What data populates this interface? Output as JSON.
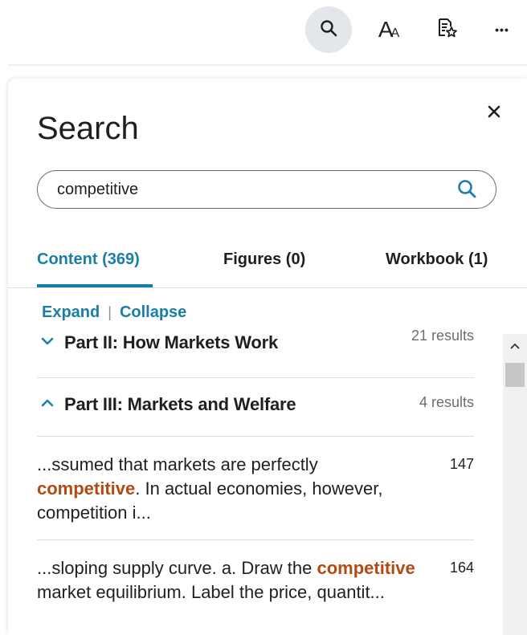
{
  "toolbar": {
    "buttons": [
      {
        "name": "search",
        "icon": "search-icon",
        "active": true
      },
      {
        "name": "font-size",
        "icon": "font-size-icon"
      },
      {
        "name": "bookmarks",
        "icon": "bookmark-list-icon"
      },
      {
        "name": "more",
        "icon": "more-dots-icon"
      }
    ],
    "font_glyph_big": "A",
    "font_glyph_small": "A",
    "more_glyph": "•••"
  },
  "panel": {
    "title": "Search",
    "close_glyph": "✕",
    "search": {
      "value": "competitive",
      "placeholder": ""
    },
    "tabs": [
      {
        "label": "Content (369)",
        "active": true
      },
      {
        "label": "Figures (0)",
        "active": false
      },
      {
        "label": "Workbook (1)",
        "active": false
      }
    ],
    "expand_label": "Expand",
    "separator": "|",
    "collapse_label": "Collapse",
    "sections": [
      {
        "title": "Part II: How Markets Work",
        "count": "21 results",
        "expanded": false
      },
      {
        "title": "Part III: Markets and Welfare",
        "count": "4 results",
        "expanded": true
      }
    ],
    "results": [
      {
        "before": "...ssumed that markets are perfectly ",
        "highlight": "competitive",
        "after": ". In actual economies, however, competition i...",
        "page": "147"
      },
      {
        "before": "...sloping supply curve. a. Draw the ",
        "highlight": "competitive",
        "after": " market equilibrium. Label the price, quantit...",
        "page": "164"
      }
    ]
  },
  "colors": {
    "accent": "#1a7fa8",
    "highlight": "#b24a14",
    "active_button_bg": "#e3e6ea",
    "muted": "#6a6e73"
  }
}
